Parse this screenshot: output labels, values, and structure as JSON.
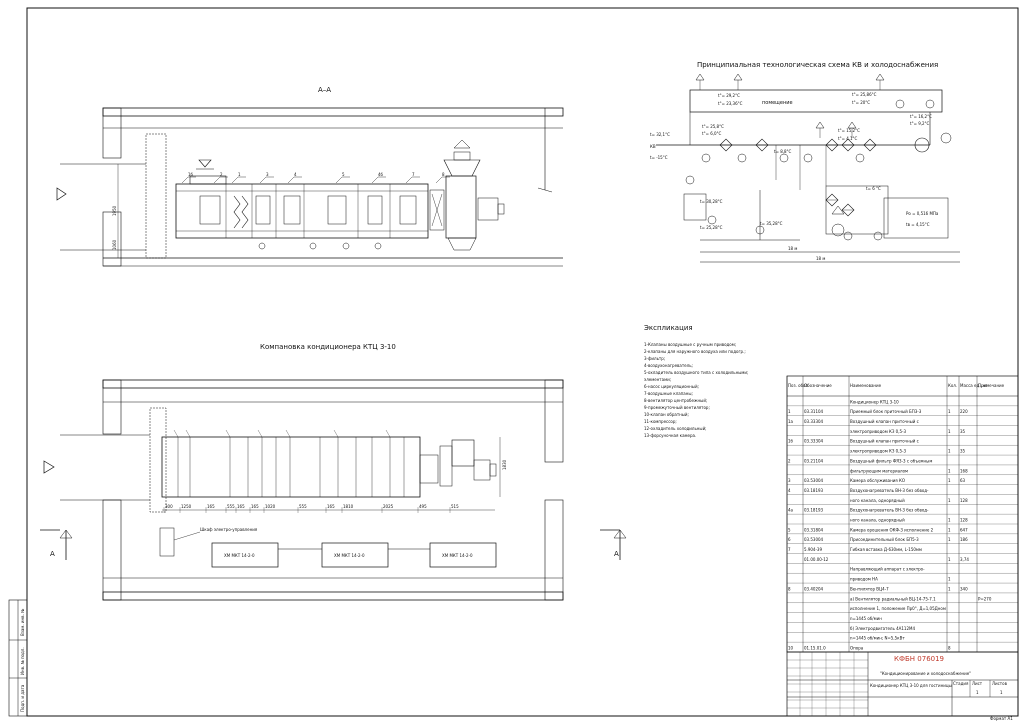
{
  "section": {
    "title": "А–А",
    "items": [
      "1б",
      "2",
      "1",
      "3",
      "4",
      "5",
      "4б",
      "7",
      "8"
    ],
    "dims_v": [
      "1950",
      "1060"
    ]
  },
  "plan": {
    "title": "Компановка кондиционера КТЦ 3-10",
    "label_frame": "Шкаф электро-управления",
    "chillers": [
      "ХМ МКТ 14-2-0",
      "ХМ МКТ 14-2-0",
      "ХМ МКТ 14-2-0"
    ],
    "cut_letter": "А",
    "dims_bottom": [
      "300",
      "1250",
      "165",
      "555",
      "165",
      "165",
      "1020",
      "555",
      "165",
      "1810",
      "2025",
      "495",
      "515"
    ],
    "dim_side": "1830"
  },
  "schema": {
    "title": "Принципиальная технологическая схема КВ и холодоснабжения",
    "room_label": "помещение",
    "temps": [
      "t°= 29,2°С",
      "t°= 23,36°С",
      "t°= 25,86°С",
      "t°= 20°С",
      "t°= 16,2°С",
      "t°= 9,2°С",
      "t°= 25,8°С",
      "t°= 6,0°С",
      "t°= 15,2°С",
      "t°= 4,1°С",
      "t= 32,1°С",
      "t= -15°С",
      "t= 8,8°С",
      "t= 30,28°С",
      "t= 25,28°С",
      "t= 35,28°С",
      "t= 6 °С",
      "tв = 4,15°С",
      "Ро = 0,516 МПа"
    ],
    "flows": [
      "18 м",
      "18 м"
    ],
    "label_kv": "КВ"
  },
  "explication": {
    "title": "Экспликация",
    "items": [
      "1-Клапаны воздушные с ручным приводом;",
      "2-клапаны для наружного воздуха или подогр.;",
      "3-фильтр;",
      "4-воздухонагреватель;",
      "5-охладитель воздушного типа с холодильными;",
      "элементами;",
      "6-насос циркуляционный;",
      "7-воздушные клапаны;",
      "8-вентилятор центробежный;",
      "9-промежуточный вентилятор;",
      "10-клапан обратный;",
      "11-компрессор;",
      "12-охладитель холодильный;",
      "13-форсуночная камера."
    ]
  },
  "spec": {
    "headers": [
      "Поз. обоз.",
      "Обозначение",
      "Наименование",
      "Кол.",
      "Масса ед., кг",
      "Примечание"
    ],
    "rows": [
      [
        "",
        "",
        "Кондиционер КТЦ 3-10",
        "",
        "",
        ""
      ],
      [
        "1",
        "03.31104",
        "Приемный блок приточный БП3-3",
        "1",
        "220",
        ""
      ],
      [
        "1а",
        "03.33304",
        "Воздушный клапан приточный с",
        "",
        "",
        ""
      ],
      [
        "",
        "",
        "электроприводом КЗ 0,5-3",
        "1",
        "35",
        ""
      ],
      [
        "1б",
        "03.33304",
        "Воздушный клапан приточный с",
        "",
        "",
        ""
      ],
      [
        "",
        "",
        "электроприводом КЗ 0,5-3",
        "1",
        "35",
        ""
      ],
      [
        "2",
        "03.21104",
        "Воздушный фильтр ФЯ3-3 с объемным",
        "",
        "",
        ""
      ],
      [
        "",
        "",
        "фильтрующим материалом",
        "1",
        "168",
        ""
      ],
      [
        "3",
        "03.53004",
        "Камера обслуживания КО",
        "1",
        "63",
        ""
      ],
      [
        "4",
        "03.18193",
        "Воздухонагреватель ВН-3 без обвод-",
        "",
        "",
        ""
      ],
      [
        "",
        "",
        "ного канала, однорядный",
        "1",
        "128",
        ""
      ],
      [
        "4а",
        "03.18193",
        "Воздухонагреватель ВН-3 без обвод-",
        "",
        "",
        ""
      ],
      [
        "",
        "",
        "ного канала, однорядный",
        "1",
        "128",
        ""
      ],
      [
        "5",
        "03.31804",
        "Камера орошения ОКФ-3 исполнение 2",
        "1",
        "647",
        ""
      ],
      [
        "6",
        "03.53004",
        "Присоединительный блок БП5-3",
        "1",
        "186",
        ""
      ],
      [
        "7",
        "5.904-39",
        "Гибкая вставка Д-630мм, L-150мм",
        "",
        "",
        ""
      ],
      [
        "",
        "01.00.00-12",
        "",
        "1",
        "3,74",
        ""
      ],
      [
        "",
        "",
        "Направляющий аппарат с электро-",
        "",
        "",
        ""
      ],
      [
        "",
        "",
        "приводом НА",
        "1",
        "",
        ""
      ],
      [
        "8",
        "03.40204",
        "Вентилятор ВЦ4-7",
        "1",
        "340",
        ""
      ],
      [
        "",
        "",
        "а) Вентилятор радиальный ВЦ-14-75-7.1",
        "",
        "",
        "Р=270"
      ],
      [
        "",
        "",
        "исполнение 1, положение Пр0°, Д=1,05Дном",
        "",
        "",
        ""
      ],
      [
        "",
        "",
        "n=1445 об/мин",
        "",
        "",
        ""
      ],
      [
        "",
        "",
        "б) Электродвигатель 4А112М4",
        "",
        "",
        ""
      ],
      [
        "",
        "",
        "n=1445 об/мин; N=5,5кВт",
        "",
        "",
        ""
      ],
      [
        "10",
        "01.15.01.0",
        "Опора",
        "8",
        "",
        ""
      ]
    ]
  },
  "stamp": {
    "code": "КФБН 076019",
    "subject": "\"Кондиционирование и холодоснабжение\"",
    "desc": "Кондиционер КТЦ 3-10 для гостиницы",
    "sheet_label": "Лист",
    "sheets_label": "Листов",
    "sheet_no": "1",
    "sheets_no": "1",
    "stage": "Стадия",
    "fmt": "Формат А1"
  },
  "sidebar": {
    "labels": [
      "Инв. № подл.",
      "Подп. и дата",
      "Взам. инв. №"
    ]
  }
}
